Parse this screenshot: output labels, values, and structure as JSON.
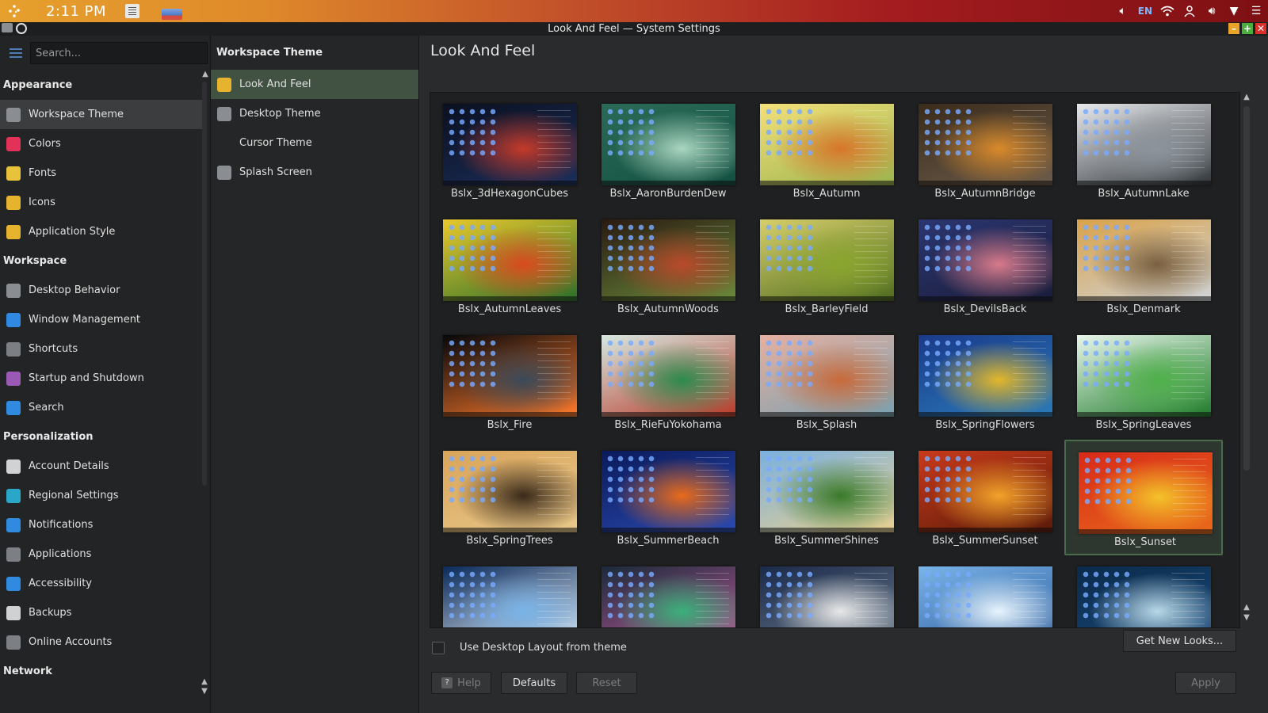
{
  "top_panel": {
    "clock": "2:11 PM",
    "lang": "EN"
  },
  "window": {
    "title": "Look And Feel — System Settings"
  },
  "sidebar": {
    "search_placeholder": "Search...",
    "categories": [
      {
        "title": "Appearance",
        "items": [
          {
            "label": "Workspace Theme",
            "icon": "workspace-theme-icon",
            "color": "#8a8d91"
          },
          {
            "label": "Colors",
            "icon": "colors-icon",
            "color": "#e3325a"
          },
          {
            "label": "Fonts",
            "icon": "fonts-icon",
            "color": "#e8c23a"
          },
          {
            "label": "Icons",
            "icon": "icons-icon",
            "color": "#e6b32e"
          },
          {
            "label": "Application Style",
            "icon": "application-style-icon",
            "color": "#e6b32e"
          }
        ]
      },
      {
        "title": "Workspace",
        "items": [
          {
            "label": "Desktop Behavior",
            "icon": "desktop-behavior-icon",
            "color": "#8a8d91"
          },
          {
            "label": "Window Management",
            "icon": "window-management-icon",
            "color": "#2f8ae0"
          },
          {
            "label": "Shortcuts",
            "icon": "shortcuts-icon",
            "color": "#7c7f83"
          },
          {
            "label": "Startup and Shutdown",
            "icon": "startup-shutdown-icon",
            "color": "#9b59b6"
          },
          {
            "label": "Search",
            "icon": "search-icon",
            "color": "#2f8ae0"
          }
        ]
      },
      {
        "title": "Personalization",
        "items": [
          {
            "label": "Account Details",
            "icon": "account-details-icon",
            "color": "#d0d2d4"
          },
          {
            "label": "Regional Settings",
            "icon": "regional-settings-icon",
            "color": "#2aa6c8"
          },
          {
            "label": "Notifications",
            "icon": "notifications-icon",
            "color": "#2f8ae0"
          },
          {
            "label": "Applications",
            "icon": "applications-icon",
            "color": "#7c7f83"
          },
          {
            "label": "Accessibility",
            "icon": "accessibility-icon",
            "color": "#2f8ae0"
          },
          {
            "label": "Backups",
            "icon": "backups-icon",
            "color": "#cfd1d3"
          },
          {
            "label": "Online Accounts",
            "icon": "online-accounts-icon",
            "color": "#7c7f83"
          }
        ]
      },
      {
        "title": "Network",
        "items": []
      }
    ],
    "active_item": "Workspace Theme"
  },
  "subpanel": {
    "title": "Workspace Theme",
    "items": [
      {
        "label": "Look And Feel",
        "icon": "look-and-feel-icon",
        "color": "#e6b32e"
      },
      {
        "label": "Desktop Theme",
        "icon": "desktop-theme-icon",
        "color": "#8a8d91"
      },
      {
        "label": "Cursor Theme",
        "icon": "",
        "color": ""
      },
      {
        "label": "Splash Screen",
        "icon": "splash-screen-icon",
        "color": "#8a8d91"
      }
    ],
    "active_item": "Look And Feel"
  },
  "main": {
    "title": "Look And Feel",
    "themes": [
      {
        "name": "Bslx_3dHexagonCubes",
        "colors": [
          "#0b1020",
          "#c43a2a",
          "#1b2e5a"
        ]
      },
      {
        "name": "Bslx_AaronBurdenDew",
        "colors": [
          "#2a6b57",
          "#a9d6c0",
          "#135041"
        ]
      },
      {
        "name": "Bslx_Autumn",
        "colors": [
          "#f4e07a",
          "#d7762a",
          "#9bb44e"
        ]
      },
      {
        "name": "Bslx_AutumnBridge",
        "colors": [
          "#3a2b1b",
          "#d98a2b",
          "#6b5b4a"
        ]
      },
      {
        "name": "Bslx_AutumnLake",
        "colors": [
          "#e7e9ec",
          "#8d949c",
          "#30353a"
        ]
      },
      {
        "name": "Bslx_AutumnLeaves",
        "colors": [
          "#e8c82c",
          "#d94a1f",
          "#2b6f2a"
        ]
      },
      {
        "name": "Bslx_AutumnWoods",
        "colors": [
          "#2a1a12",
          "#b9492a",
          "#6a8a3a"
        ]
      },
      {
        "name": "Bslx_BarleyField",
        "colors": [
          "#d7cf6a",
          "#8aa62e",
          "#4d6a1e"
        ]
      },
      {
        "name": "Bslx_DevilsBack",
        "colors": [
          "#2b3670",
          "#d77a8a",
          "#1a1d3a"
        ]
      },
      {
        "name": "Bslx_Denmark",
        "colors": [
          "#d9a24a",
          "#7a6040",
          "#cfd4d8"
        ]
      },
      {
        "name": "Bslx_Fire",
        "colors": [
          "#05070b",
          "#3a4a5a",
          "#ff7a2a"
        ]
      },
      {
        "name": "Bslx_RieFuYokohama",
        "colors": [
          "#d6e8e0",
          "#2d8a4e",
          "#b83a2a"
        ]
      },
      {
        "name": "Bslx_Splash",
        "colors": [
          "#e6b0a0",
          "#c86a3a",
          "#7aa0b0"
        ]
      },
      {
        "name": "Bslx_SpringFlowers",
        "colors": [
          "#1a3a8a",
          "#e2b72a",
          "#2a7ab8"
        ]
      },
      {
        "name": "Bslx_SpringLeaves",
        "colors": [
          "#e8f6ea",
          "#4fb04a",
          "#1e7a2a"
        ]
      },
      {
        "name": "Bslx_SpringTrees",
        "colors": [
          "#d9a45a",
          "#3a2a1a",
          "#e8c88a"
        ]
      },
      {
        "name": "Bslx_SummerBeach",
        "colors": [
          "#0a1a5a",
          "#e86a1a",
          "#2a4ab0"
        ]
      },
      {
        "name": "Bslx_SummerShines",
        "colors": [
          "#7ab0e0",
          "#3a7a2a",
          "#e8d090"
        ]
      },
      {
        "name": "Bslx_SummerSunset",
        "colors": [
          "#c83a1a",
          "#f2a22a",
          "#5a1a0a"
        ]
      },
      {
        "name": "Bslx_Sunset",
        "colors": [
          "#d82a1a",
          "#f4c22a",
          "#e86a1a"
        ]
      },
      {
        "name": "",
        "colors": [
          "#0a2a5a",
          "#7ab4e8",
          "#e8f0f8"
        ]
      },
      {
        "name": "",
        "colors": [
          "#1a2a3a",
          "#3ab07a",
          "#c05a9a"
        ]
      },
      {
        "name": "",
        "colors": [
          "#1a2a4a",
          "#e8e8e8",
          "#6a7a8a"
        ]
      },
      {
        "name": "",
        "colors": [
          "#7ab4e8",
          "#e8f4fc",
          "#2a5a9a"
        ]
      },
      {
        "name": "",
        "colors": [
          "#0a2a4a",
          "#b8d8e8",
          "#1a4a7a"
        ]
      }
    ],
    "selected_theme": "Bslx_Sunset",
    "checkbox_label": "Use Desktop Layout from theme",
    "get_new_looks": "Get New Looks...",
    "help": "Help",
    "defaults": "Defaults",
    "reset": "Reset",
    "apply": "Apply"
  }
}
